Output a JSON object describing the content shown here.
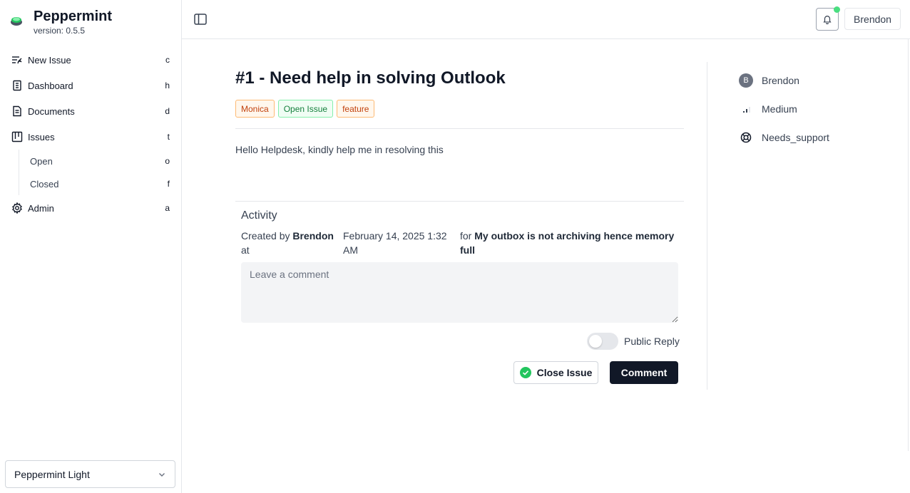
{
  "app": {
    "name": "Peppermint",
    "version": "version: 0.5.5"
  },
  "sidebar": {
    "items": [
      {
        "label": "New Issue",
        "key": "c",
        "icon": "new-issue-icon"
      },
      {
        "label": "Dashboard",
        "key": "h",
        "icon": "dashboard-icon"
      },
      {
        "label": "Documents",
        "key": "d",
        "icon": "documents-icon"
      },
      {
        "label": "Issues",
        "key": "t",
        "icon": "issues-icon"
      },
      {
        "label": "Admin",
        "key": "a",
        "icon": "gear-icon"
      }
    ],
    "sub_items": [
      {
        "label": "Open",
        "key": "o"
      },
      {
        "label": "Closed",
        "key": "f"
      }
    ],
    "theme": "Peppermint Light"
  },
  "topbar": {
    "user": "Brendon",
    "notification_dot_color": "#4ade80"
  },
  "issue": {
    "title": "#1 - Need help in solving Outlook",
    "tags": [
      "Monica",
      "Open Issue",
      "feature"
    ],
    "body": "Hello Helpdesk, kindly help me in resolving this"
  },
  "activity": {
    "heading": "Activity",
    "created_by_prefix": "Created by",
    "created_by_name": "Brendon",
    "at_word": "at",
    "timestamp": "February 14, 2025 1:32 AM",
    "for_word": "for",
    "for_text": "My outbox is not archiving hence memory full",
    "comment_placeholder": "Leave a comment",
    "public_reply_label": "Public Reply",
    "public_reply_on": false,
    "close_label": "Close Issue",
    "comment_label": "Comment"
  },
  "details": {
    "assignee": "Brendon",
    "assignee_initial": "B",
    "priority": "Medium",
    "status": "Needs_support"
  }
}
